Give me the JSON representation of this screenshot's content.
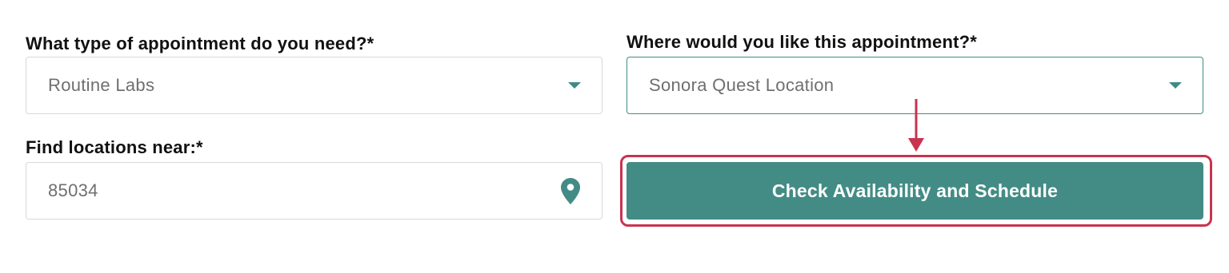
{
  "appointment_type": {
    "label": "What type of appointment do you need?*",
    "value": "Routine Labs"
  },
  "appointment_location": {
    "label": "Where would you like this appointment?*",
    "value": "Sonora Quest Location"
  },
  "find_near": {
    "label": "Find locations near:*",
    "value": "85034"
  },
  "actions": {
    "check_availability_label": "Check Availability and Schedule"
  },
  "icons": {
    "dropdown": "chevron-down-icon",
    "location": "map-pin-icon"
  },
  "colors": {
    "accent": "#428c85",
    "highlight": "#c8334f"
  }
}
